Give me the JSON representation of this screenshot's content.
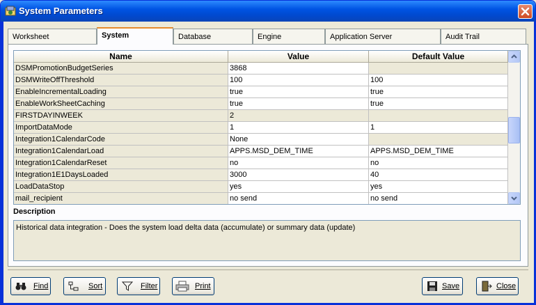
{
  "window": {
    "title": "System Parameters"
  },
  "tabs": [
    {
      "label": "Worksheet"
    },
    {
      "label": "System"
    },
    {
      "label": "Database"
    },
    {
      "label": "Engine"
    },
    {
      "label": "Application Server"
    },
    {
      "label": "Audit Trail"
    }
  ],
  "grid": {
    "columns": [
      "Name",
      "Value",
      "Default Value"
    ],
    "rows": [
      {
        "name": "DSMPromotionBudgetSeries",
        "value": "3868",
        "default": ""
      },
      {
        "name": "DSMWriteOffThreshold",
        "value": "100",
        "default": "100"
      },
      {
        "name": "EnableIncrementalLoading",
        "value": "true",
        "default": "true"
      },
      {
        "name": "EnableWorkSheetCaching",
        "value": "true",
        "default": "true"
      },
      {
        "name": "FIRSTDAYINWEEK",
        "value": "2",
        "default": ""
      },
      {
        "name": "ImportDataMode",
        "value": "1",
        "default": "1"
      },
      {
        "name": "Integration1CalendarCode",
        "value": "None",
        "default": ""
      },
      {
        "name": "Integration1CalendarLoad",
        "value": "APPS.MSD_DEM_TIME",
        "default": "APPS.MSD_DEM_TIME"
      },
      {
        "name": "Integration1CalendarReset",
        "value": "no",
        "default": "no"
      },
      {
        "name": "Integration1E1DaysLoaded",
        "value": "3000",
        "default": "40"
      },
      {
        "name": "LoadDataStop",
        "value": "yes",
        "default": "yes"
      },
      {
        "name": "mail_recipient",
        "value": "no send",
        "default": "no send"
      }
    ]
  },
  "description": {
    "label": "Description",
    "text": "Historical data integration - Does the system load delta data (accumulate) or summary data (update)"
  },
  "buttons": {
    "find": "Find",
    "sort": "Sort",
    "filter": "Filter",
    "print": "Print",
    "save": "Save",
    "close": "Close"
  },
  "icons": [
    "app-icon",
    "close-icon",
    "binoculars-icon",
    "sort-icon",
    "filter-icon",
    "printer-icon",
    "floppy-disk-icon",
    "exit-door-icon",
    "scroll-up-icon",
    "scroll-down-icon"
  ],
  "colors": {
    "titlebar": "#0054e3",
    "window": "#ece9d8",
    "active_tab_accent": "#e68b2c"
  }
}
